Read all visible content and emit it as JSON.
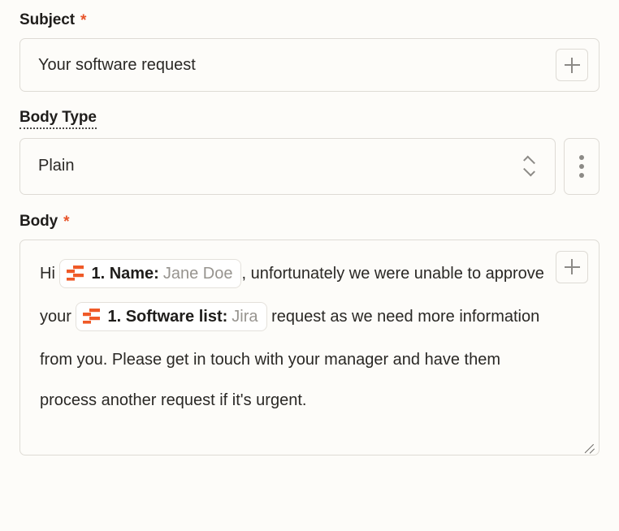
{
  "theme": {
    "page_bg": "#fdfcf9",
    "border": "#dedbd5",
    "text": "#22201e",
    "required_star": "#e8542a",
    "token_icon": "#ef5a28",
    "placeholder_text": "#97948f"
  },
  "subject": {
    "label": "Subject",
    "required_mark": "*",
    "value": "Your software request",
    "add_button_label": "+"
  },
  "body_type": {
    "label": "Body Type",
    "selected": "Plain",
    "options": [
      "Plain"
    ],
    "menu_button_label": "⋮"
  },
  "body": {
    "label": "Body",
    "required_mark": "*",
    "add_button_label": "+",
    "segments": [
      {
        "kind": "text",
        "text": "Hi "
      },
      {
        "kind": "token",
        "name": "1. Name:",
        "value": "Jane Doe",
        "icon": "variable-icon"
      },
      {
        "kind": "text",
        "text": ", unfortunately we were unable to approve your "
      },
      {
        "kind": "token",
        "name": "1. Software list:",
        "value": "Jira",
        "icon": "variable-icon"
      },
      {
        "kind": "text",
        "text": " request as we need more information from you. Please get in touch with your manager and have them process another request if it's urgent."
      }
    ]
  }
}
